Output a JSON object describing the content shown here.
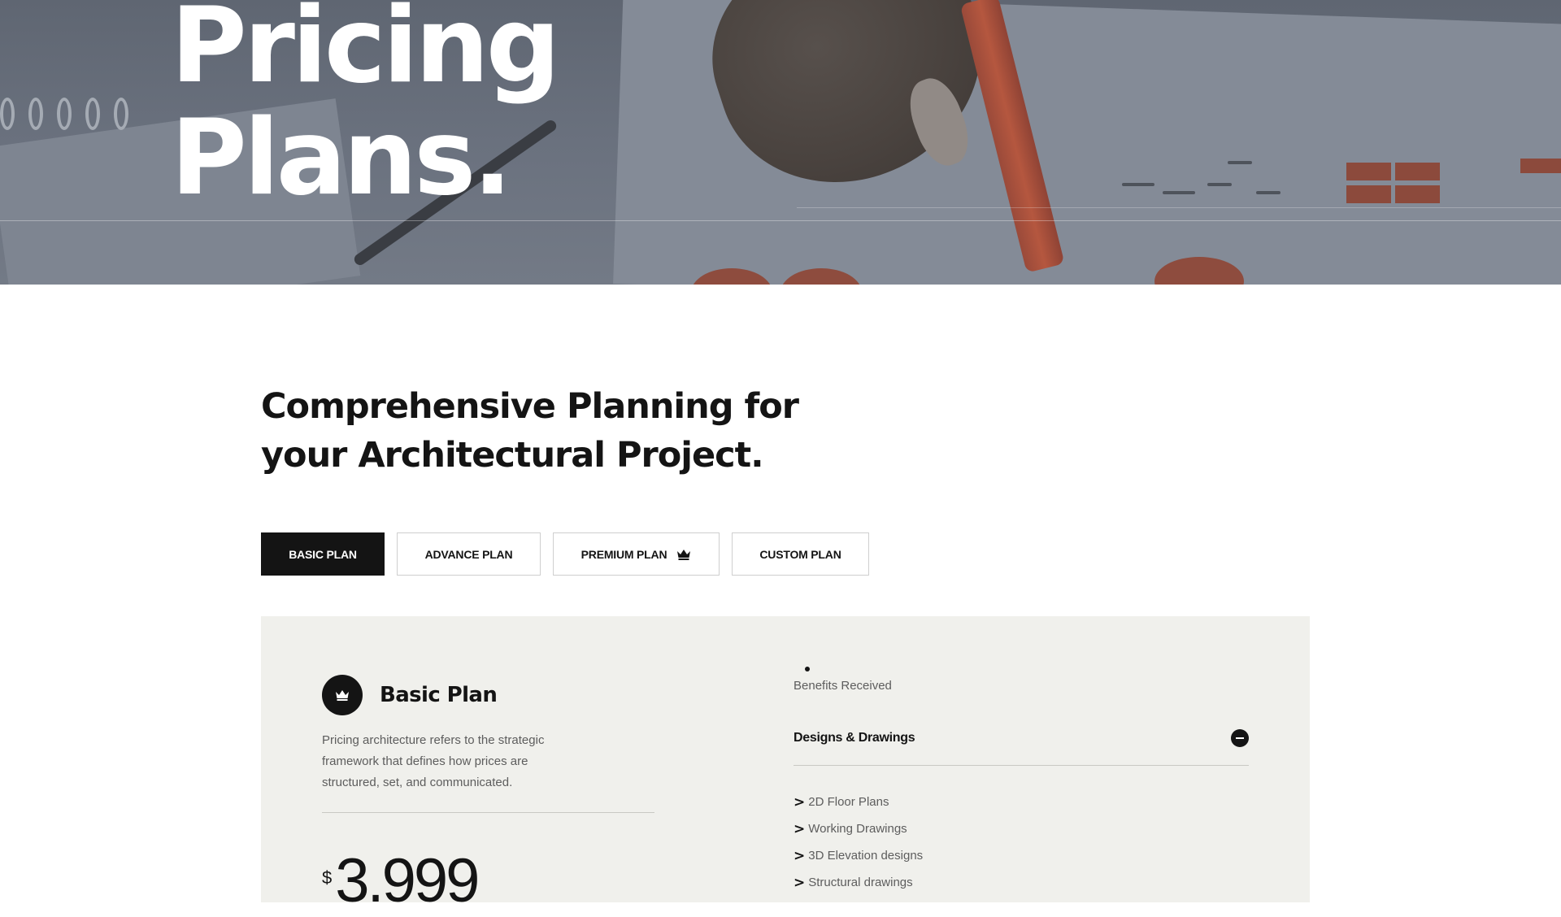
{
  "hero": {
    "title_line1": "Pricing",
    "title_line2": "Plans."
  },
  "section": {
    "headline_line1": "Comprehensive Planning for",
    "headline_line2": "your Architectural Project."
  },
  "tabs": [
    {
      "label": "BASIC PLAN",
      "active": true
    },
    {
      "label": "ADVANCE PLAN",
      "active": false
    },
    {
      "label": "PREMIUM PLAN",
      "active": false,
      "icon": "crown-icon"
    },
    {
      "label": "CUSTOM PLAN",
      "active": false
    }
  ],
  "plan": {
    "icon": "crown-icon",
    "name": "Basic Plan",
    "description": "Pricing architecture refers to the strategic framework that defines how prices are structured, set, and communicated.",
    "currency": "$",
    "price": "3.999"
  },
  "benefits": {
    "label": "Benefits Received",
    "accordion": {
      "title": "Designs & Drawings",
      "state_icon": "minus-icon",
      "items": [
        "2D Floor Plans",
        "Working Drawings",
        "3D Elevation designs",
        "Structural drawings"
      ]
    }
  },
  "colors": {
    "accent": "#141414",
    "card_bg": "#f0f0ec",
    "muted_text": "#5d5d5d"
  }
}
